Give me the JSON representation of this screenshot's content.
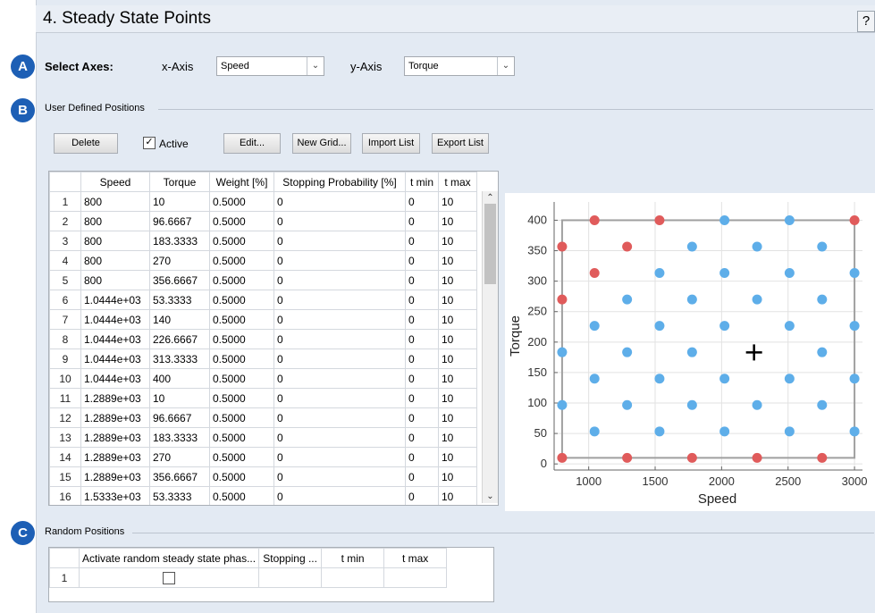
{
  "section": {
    "title": "4. Steady State Points",
    "help": "?"
  },
  "badges": {
    "a": "A",
    "b": "B",
    "c": "C"
  },
  "axes": {
    "label": "Select Axes:",
    "x_label": "x-Axis",
    "x_value": "Speed",
    "y_label": "y-Axis",
    "y_value": "Torque"
  },
  "user_defined": {
    "group_label": "User Defined Positions",
    "buttons": {
      "delete": "Delete",
      "edit": "Edit...",
      "new_grid": "New Grid...",
      "import": "Import List",
      "export": "Export List"
    },
    "active_label": "Active",
    "active_checked": true,
    "columns": [
      "Speed",
      "Torque",
      "Weight [%]",
      "Stopping Probability [%]",
      "t min",
      "t max"
    ],
    "rows": [
      [
        "1",
        "800",
        "10",
        "0.5000",
        "0",
        "0",
        "10"
      ],
      [
        "2",
        "800",
        "96.6667",
        "0.5000",
        "0",
        "0",
        "10"
      ],
      [
        "3",
        "800",
        "183.3333",
        "0.5000",
        "0",
        "0",
        "10"
      ],
      [
        "4",
        "800",
        "270",
        "0.5000",
        "0",
        "0",
        "10"
      ],
      [
        "5",
        "800",
        "356.6667",
        "0.5000",
        "0",
        "0",
        "10"
      ],
      [
        "6",
        "1.0444e+03",
        "53.3333",
        "0.5000",
        "0",
        "0",
        "10"
      ],
      [
        "7",
        "1.0444e+03",
        "140",
        "0.5000",
        "0",
        "0",
        "10"
      ],
      [
        "8",
        "1.0444e+03",
        "226.6667",
        "0.5000",
        "0",
        "0",
        "10"
      ],
      [
        "9",
        "1.0444e+03",
        "313.3333",
        "0.5000",
        "0",
        "0",
        "10"
      ],
      [
        "10",
        "1.0444e+03",
        "400",
        "0.5000",
        "0",
        "0",
        "10"
      ],
      [
        "11",
        "1.2889e+03",
        "10",
        "0.5000",
        "0",
        "0",
        "10"
      ],
      [
        "12",
        "1.2889e+03",
        "96.6667",
        "0.5000",
        "0",
        "0",
        "10"
      ],
      [
        "13",
        "1.2889e+03",
        "183.3333",
        "0.5000",
        "0",
        "0",
        "10"
      ],
      [
        "14",
        "1.2889e+03",
        "270",
        "0.5000",
        "0",
        "0",
        "10"
      ],
      [
        "15",
        "1.2889e+03",
        "356.6667",
        "0.5000",
        "0",
        "0",
        "10"
      ],
      [
        "16",
        "1.5333e+03",
        "53.3333",
        "0.5000",
        "0",
        "0",
        "10"
      ]
    ]
  },
  "chart_data": {
    "type": "scatter",
    "xlabel": "Speed",
    "ylabel": "Torque",
    "xlim": [
      740,
      3060
    ],
    "ylim": [
      -10,
      430
    ],
    "xticks": [
      1000,
      1500,
      2000,
      2500,
      3000
    ],
    "yticks": [
      0,
      50,
      100,
      150,
      200,
      250,
      300,
      350,
      400
    ],
    "grid": true,
    "colors": {
      "red": "#e05b5b",
      "blue": "#5eaee9",
      "box": "#a0a0a0"
    },
    "bounding_box": {
      "x": [
        800,
        3000
      ],
      "y": [
        10,
        400
      ]
    },
    "center_marker": {
      "x": 2244,
      "y": 183
    },
    "series": [
      {
        "color": "red",
        "points": [
          [
            800,
            10
          ],
          [
            800,
            270
          ],
          [
            800,
            356.67
          ],
          [
            1044,
            313.33
          ],
          [
            1044,
            400
          ],
          [
            1289,
            10
          ],
          [
            1289,
            356.67
          ],
          [
            1533,
            400
          ],
          [
            1778,
            10
          ],
          [
            2267,
            10
          ],
          [
            2756,
            10
          ],
          [
            3000,
            400
          ]
        ]
      },
      {
        "color": "blue",
        "points": [
          [
            800,
            96.67
          ],
          [
            800,
            183.33
          ],
          [
            1044,
            53.33
          ],
          [
            1044,
            140
          ],
          [
            1044,
            226.67
          ],
          [
            1289,
            96.67
          ],
          [
            1289,
            183.33
          ],
          [
            1289,
            270
          ],
          [
            1533,
            53.33
          ],
          [
            1533,
            140
          ],
          [
            1533,
            226.67
          ],
          [
            1533,
            313.33
          ],
          [
            1778,
            96.67
          ],
          [
            1778,
            183.33
          ],
          [
            1778,
            270
          ],
          [
            1778,
            356.67
          ],
          [
            2022,
            53.33
          ],
          [
            2022,
            140
          ],
          [
            2022,
            226.67
          ],
          [
            2022,
            313.33
          ],
          [
            2022,
            400
          ],
          [
            2267,
            96.67
          ],
          [
            2267,
            270
          ],
          [
            2267,
            356.67
          ],
          [
            2511,
            53.33
          ],
          [
            2511,
            140
          ],
          [
            2511,
            226.67
          ],
          [
            2511,
            313.33
          ],
          [
            2511,
            400
          ],
          [
            2756,
            96.67
          ],
          [
            2756,
            183.33
          ],
          [
            2756,
            270
          ],
          [
            2756,
            356.67
          ],
          [
            3000,
            53.33
          ],
          [
            3000,
            140
          ],
          [
            3000,
            226.67
          ],
          [
            3000,
            313.33
          ]
        ]
      }
    ]
  },
  "random": {
    "group_label": "Random Positions",
    "columns": [
      "Activate random steady state phas...",
      "Stopping ...",
      "t min",
      "t max"
    ],
    "row_number": "1",
    "checked": false
  }
}
